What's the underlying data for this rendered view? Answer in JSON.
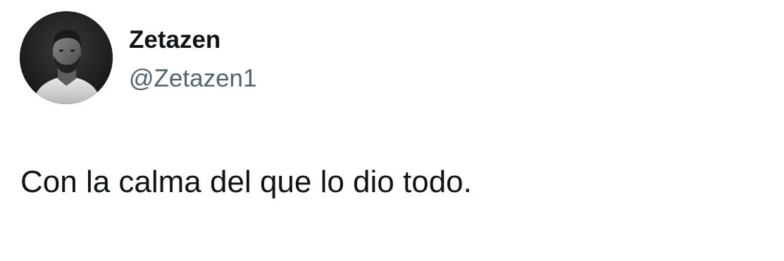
{
  "tweet": {
    "author": {
      "display_name": "Zetazen",
      "handle": "@Zetazen1",
      "avatar_icon": "profile-photo"
    },
    "text": "Con la calma del que lo dio todo."
  },
  "colors": {
    "background": "#ffffff",
    "text_primary": "#0f1419",
    "text_secondary": "#536471"
  }
}
